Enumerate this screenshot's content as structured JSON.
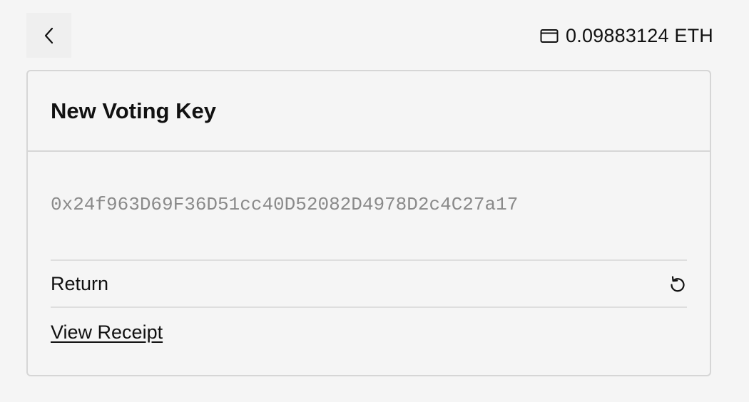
{
  "nav": {
    "back_icon": "chevron-left-icon"
  },
  "wallet": {
    "icon": "wallet-icon",
    "balance": "0.09883124 ETH"
  },
  "card": {
    "title": "New Voting Key",
    "address": "0x24f963D69F36D51cc40D52082D4978D2c4C27a17",
    "return_label": "Return",
    "return_icon": "rotate-ccw-icon",
    "receipt_link": "View Receipt"
  },
  "colors": {
    "background": "#f5f5f5",
    "border": "#d6d6d6",
    "muted_text": "#8a8a8a",
    "text": "#111111"
  }
}
